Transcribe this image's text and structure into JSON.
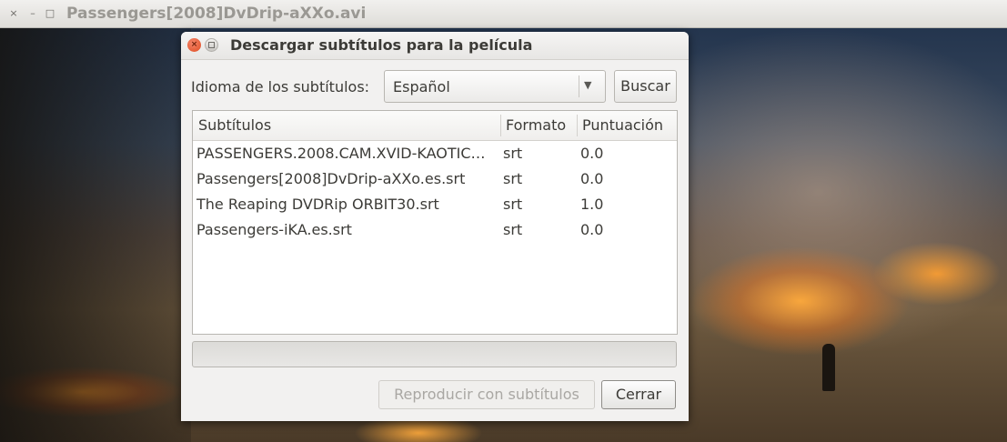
{
  "player": {
    "title": "Passengers[2008]DvDrip-aXXo.avi",
    "close_glyph": "×",
    "minimize_glyph": "–",
    "maximize_glyph": "□"
  },
  "dialog": {
    "title": "Descargar subtítulos para la película",
    "close_glyph": "×",
    "language_label": "Idioma de los subtítulos:",
    "language_value": "Español",
    "combo_arrow": "▼",
    "search_button": "Buscar",
    "columns": [
      "Subtítulos",
      "Formato",
      "Puntuación"
    ],
    "rows": [
      {
        "name": "PASSENGERS.2008.CAM.XVID-KAOTIC…",
        "format": "srt",
        "score": "0.0"
      },
      {
        "name": "Passengers[2008]DvDrip-aXXo.es.srt",
        "format": "srt",
        "score": "0.0"
      },
      {
        "name": "The Reaping DVDRip ORBIT30.srt",
        "format": "srt",
        "score": "1.0"
      },
      {
        "name": "Passengers-iKA.es.srt",
        "format": "srt",
        "score": "0.0"
      }
    ],
    "progress_fraction": 0,
    "play_button": "Reproducir con subtítulos",
    "close_button": "Cerrar"
  },
  "colors": {
    "accent": "#f07746",
    "close_dot": "#de4c22"
  }
}
